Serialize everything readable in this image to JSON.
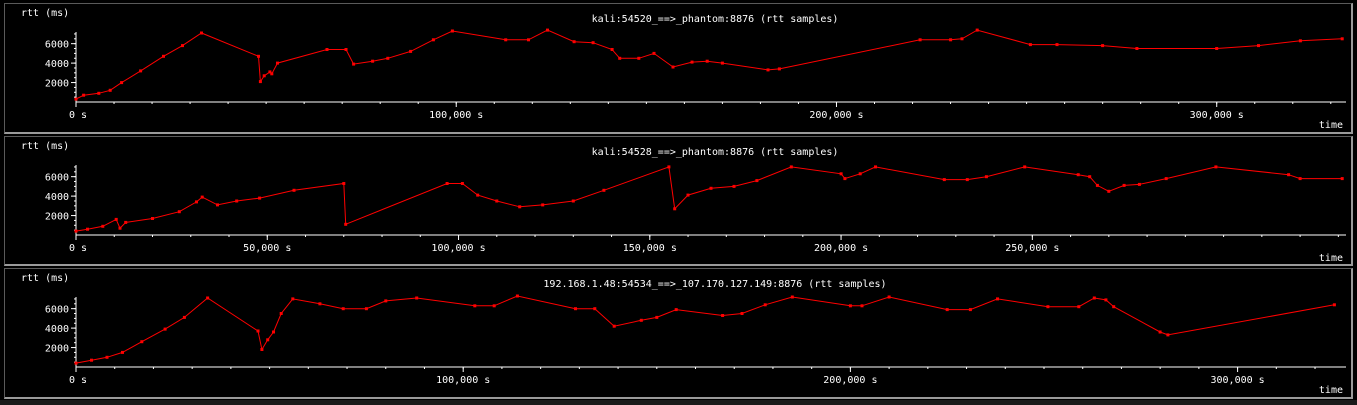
{
  "chart_data": [
    {
      "type": "line",
      "title": "kali:54520_==>_phantom:8876 (rtt samples)",
      "ylabel": "rtt (ms)",
      "xlabel": "time",
      "xlim": [
        0,
        334000
      ],
      "ylim": [
        0,
        7200
      ],
      "x_ticks": [
        {
          "value": 0,
          "label": "0 s"
        },
        {
          "value": 100000,
          "label": "100,000  s"
        },
        {
          "value": 200000,
          "label": "200,000  s"
        },
        {
          "value": 300000,
          "label": "300,000  s"
        }
      ],
      "y_ticks": [
        2000,
        4000,
        6000
      ],
      "color": "#ff0000",
      "series": [
        {
          "x": [
            0,
            2000,
            6000,
            9000,
            12000,
            17000,
            23000,
            28000,
            33000,
            48000,
            48500,
            49500,
            51000,
            51500,
            53000,
            66000,
            71000,
            73000,
            78000,
            82000,
            88000,
            94000,
            99000,
            113000,
            119000,
            124000,
            131000,
            136000,
            141000,
            143000,
            148000,
            152000,
            157000,
            162000,
            166000,
            170000,
            182000,
            185000,
            222000,
            230000,
            233000,
            237000,
            251000,
            258000,
            270000,
            279000,
            300000,
            311000,
            322000,
            333000
          ],
          "y": [
            300,
            700,
            900,
            1200,
            2000,
            3200,
            4700,
            5800,
            7100,
            4700,
            2100,
            2700,
            3100,
            2900,
            4000,
            5400,
            5400,
            3900,
            4200,
            4500,
            5200,
            6400,
            7300,
            6400,
            6400,
            7400,
            6200,
            6100,
            5400,
            4500,
            4500,
            5000,
            3600,
            4100,
            4200,
            4000,
            3300,
            3400,
            6400,
            6400,
            6500,
            7400,
            5900,
            5900,
            5800,
            5500,
            5500,
            5800,
            6300,
            6500
          ]
        }
      ]
    },
    {
      "type": "line",
      "title": "kali:54528_==>_phantom:8876 (rtt samples)",
      "ylabel": "rtt (ms)",
      "xlabel": "time",
      "xlim": [
        0,
        332000
      ],
      "ylim": [
        0,
        7200
      ],
      "x_ticks": [
        {
          "value": 0,
          "label": "0 s"
        },
        {
          "value": 50000,
          "label": "50,000  s"
        },
        {
          "value": 100000,
          "label": "100,000  s"
        },
        {
          "value": 150000,
          "label": "150,000  s"
        },
        {
          "value": 200000,
          "label": "200,000  s"
        },
        {
          "value": 250000,
          "label": "250,000  s"
        }
      ],
      "y_ticks": [
        2000,
        4000,
        6000
      ],
      "color": "#ff0000",
      "series": [
        {
          "x": [
            0,
            3000,
            7000,
            10500,
            11500,
            13000,
            20000,
            27000,
            31500,
            33000,
            37000,
            42000,
            48000,
            57000,
            70000,
            70500,
            97000,
            101000,
            105000,
            110000,
            116000,
            122000,
            130000,
            138000,
            155000,
            156500,
            160000,
            166000,
            172000,
            178000,
            187000,
            200000,
            201000,
            205000,
            209000,
            227000,
            233000,
            238000,
            248000,
            262000,
            265000,
            267000,
            270000,
            274000,
            278000,
            285000,
            298000,
            317000,
            320000,
            331000
          ],
          "y": [
            400,
            600,
            900,
            1600,
            700,
            1300,
            1700,
            2400,
            3400,
            3900,
            3100,
            3500,
            3800,
            4600,
            5300,
            1100,
            5300,
            5300,
            4100,
            3500,
            2900,
            3100,
            3500,
            4600,
            7000,
            2700,
            4100,
            4800,
            5000,
            5600,
            7000,
            6300,
            5800,
            6300,
            7000,
            5700,
            5700,
            6000,
            7000,
            6200,
            6000,
            5100,
            4500,
            5100,
            5200,
            5800,
            7000,
            6200,
            5800,
            5800
          ]
        }
      ]
    },
    {
      "type": "line",
      "title": "192.168.1.48:54534_==>_107.170.127.149:8876 (rtt samples)",
      "ylabel": "rtt (ms)",
      "xlabel": "time",
      "xlim": [
        0,
        328000
      ],
      "ylim": [
        0,
        7200
      ],
      "x_ticks": [
        {
          "value": 0,
          "label": "0 s"
        },
        {
          "value": 100000,
          "label": "100,000  s"
        },
        {
          "value": 200000,
          "label": "200,000  s"
        },
        {
          "value": 300000,
          "label": "300,000  s"
        }
      ],
      "y_ticks": [
        2000,
        4000,
        6000
      ],
      "color": "#ff0000",
      "series": [
        {
          "x": [
            0,
            4000,
            8000,
            12000,
            17000,
            23000,
            28000,
            34000,
            47000,
            48000,
            49500,
            51000,
            53000,
            56000,
            63000,
            69000,
            75000,
            80000,
            88000,
            103000,
            108000,
            114000,
            129000,
            134000,
            139000,
            146000,
            150000,
            155000,
            167000,
            172000,
            178000,
            185000,
            200000,
            203000,
            210000,
            225000,
            231000,
            238000,
            251000,
            259000,
            263000,
            266000,
            268000,
            280000,
            282000,
            325000
          ],
          "y": [
            400,
            700,
            1000,
            1500,
            2600,
            3900,
            5100,
            7100,
            3700,
            1800,
            2800,
            3600,
            5500,
            7000,
            6500,
            6000,
            6000,
            6800,
            7100,
            6300,
            6300,
            7300,
            6000,
            6000,
            4200,
            4800,
            5100,
            5900,
            5300,
            5500,
            6400,
            7200,
            6300,
            6300,
            7200,
            5900,
            5900,
            7000,
            6200,
            6200,
            7100,
            6900,
            6200,
            3600,
            3300,
            6400
          ]
        }
      ]
    }
  ]
}
